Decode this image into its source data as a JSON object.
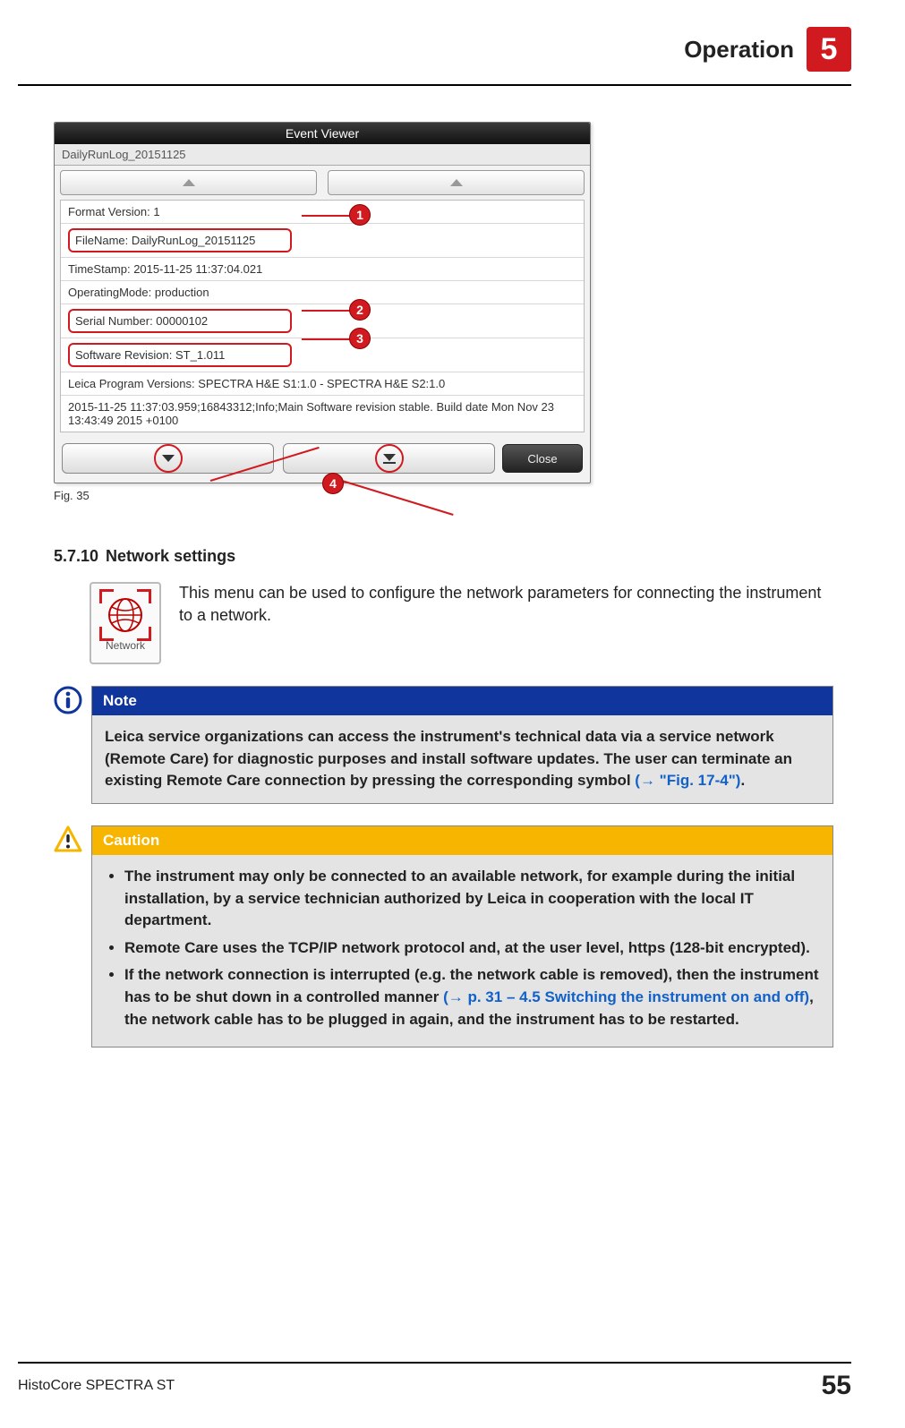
{
  "header": {
    "title": "Operation",
    "chapter": "5"
  },
  "eventViewer": {
    "title": "Event Viewer",
    "subtitle": "DailyRunLog_20151125",
    "rows": {
      "formatVersion": "Format Version: 1",
      "fileName": "FileName: DailyRunLog_20151125",
      "timeStamp": "TimeStamp: 2015-11-25 11:37:04.021",
      "operatingMode": "OperatingMode: production",
      "serial": "Serial Number: 00000102",
      "software": "Software Revision: ST_1.011",
      "programs": "Leica Program Versions: SPECTRA H&E S1:1.0 - SPECTRA H&E S2:1.0",
      "log": "2015-11-25 11:37:03.959;16843312;Info;Main Software revision stable. Build date Mon Nov 23 13:43:49 2015 +0100"
    },
    "closeLabel": "Close",
    "callouts": {
      "c1": "1",
      "c2": "2",
      "c3": "3",
      "c4": "4"
    }
  },
  "figCaption": "Fig. 35",
  "section": {
    "num": "5.7.10",
    "title": "Network settings"
  },
  "networkIcon": {
    "label": "Network"
  },
  "introText": "This menu can be used to configure the network parameters for connecting the instrument to a network.",
  "note": {
    "head": "Note",
    "body_pre": "Leica service organizations can access the instrument's technical data via a service network (Remote Care) for diagnostic purposes and install software updates. The user can terminate an existing Remote Care connection by pressing the corresponding symbol ",
    "link": "(→ \"Fig. 17-4\")",
    "body_post": "."
  },
  "caution": {
    "head": "Caution",
    "b1": "The instrument may only be connected to an available network, for example during the initial installation, by a service technician authorized by Leica in cooperation with the local IT department.",
    "b2": "Remote Care uses the TCP/IP network protocol and, at the user level, https (128-bit encrypted).",
    "b3a": "If the network connection is interrupted (e.g. the network cable is removed), then the instrument has to be shut down in a controlled manner ",
    "b3link": "(→ p. 31 – 4.5 Switching the instrument on and off)",
    "b3b": ", the network cable has to be plugged in again, and the instrument has to be restarted."
  },
  "footer": {
    "product": "HistoCore SPECTRA ST",
    "page": "55"
  }
}
